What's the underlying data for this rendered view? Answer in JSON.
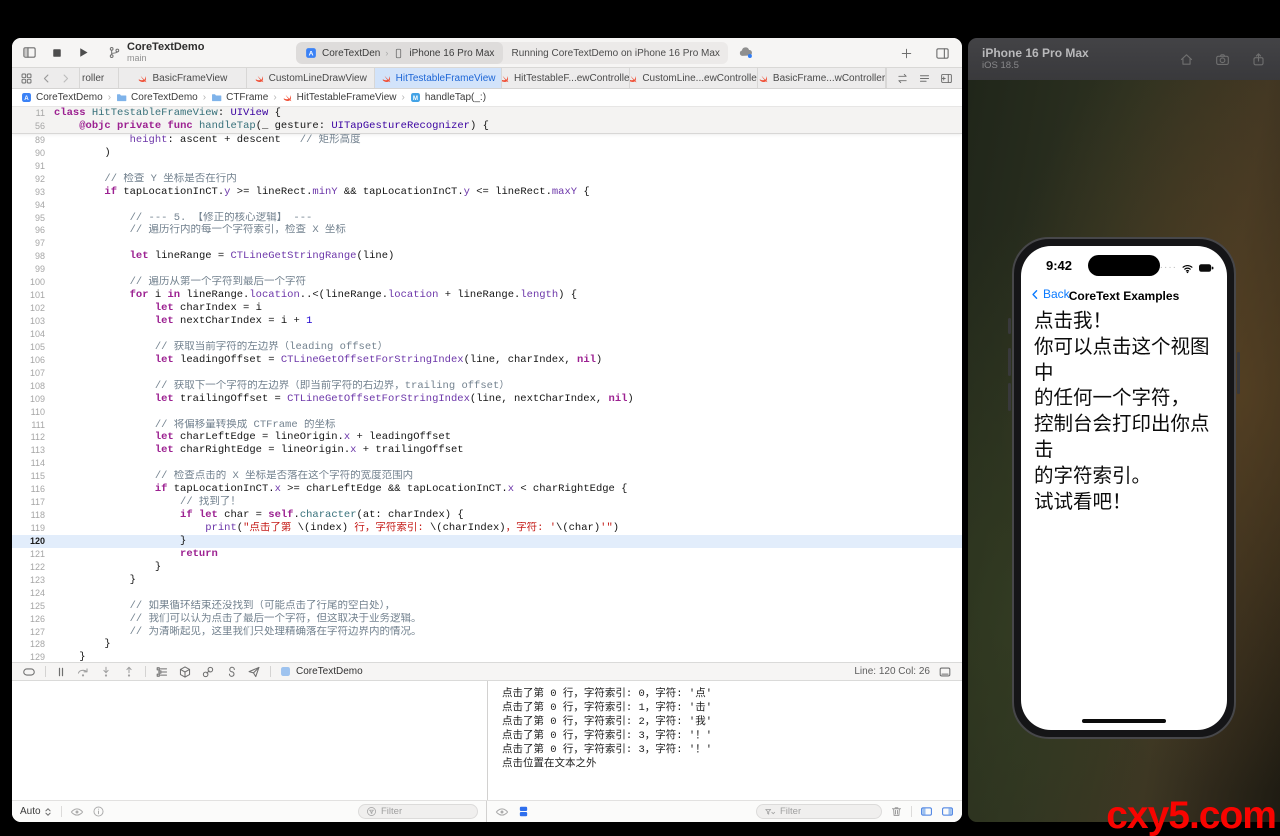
{
  "window": {
    "project": "CoreTextDemo",
    "branch": "main",
    "scheme": "CoreTextDen",
    "device": "iPhone 16 Pro Max",
    "run_status": "Running CoreTextDemo on iPhone 16 Pro Max",
    "chevron": "›"
  },
  "tabbar": {
    "tabs": [
      {
        "label": "roller",
        "clipped": true,
        "active": false
      },
      {
        "label": "BasicFrameView",
        "active": false
      },
      {
        "label": "CustomLineDrawView",
        "active": false
      },
      {
        "label": "HitTestableFrameView",
        "active": true
      },
      {
        "label": "HitTestableF...ewController",
        "active": false
      },
      {
        "label": "CustomLine...ewController",
        "active": false
      },
      {
        "label": "BasicFrame...wController",
        "active": false
      }
    ]
  },
  "breadcrumb": {
    "items": [
      {
        "icon": "app",
        "label": "CoreTextDemo"
      },
      {
        "icon": "folder",
        "label": "CoreTextDemo"
      },
      {
        "icon": "folder",
        "label": "CTFrame"
      },
      {
        "icon": "swift",
        "label": "HitTestableFrameView"
      },
      {
        "icon": "method",
        "label": "handleTap(_:)"
      }
    ]
  },
  "editor": {
    "current_line": 120,
    "sticky_lines": [
      {
        "n": 11,
        "t": [
          [
            "k",
            "class "
          ],
          [
            "t",
            "HitTestableFrameView"
          ],
          [
            "p",
            ": "
          ],
          [
            "F",
            "UIView"
          ],
          [
            "p",
            " {"
          ]
        ]
      },
      {
        "n": 56,
        "t": [
          [
            "p",
            "    "
          ],
          [
            "k",
            "@objc"
          ],
          [
            "p",
            " "
          ],
          [
            "k",
            "private"
          ],
          [
            "p",
            " "
          ],
          [
            "k",
            "func"
          ],
          [
            "p",
            " "
          ],
          [
            "t",
            "handleTap"
          ],
          [
            "p",
            "(_ gesture: "
          ],
          [
            "F",
            "UITapGestureRecognizer"
          ],
          [
            "p",
            ") {"
          ]
        ]
      }
    ],
    "lines": [
      {
        "n": 89,
        "t": [
          [
            "p",
            "            "
          ],
          [
            "f",
            "height"
          ],
          [
            "p",
            ": ascent + descent   "
          ],
          [
            "c",
            "// 矩形高度"
          ]
        ]
      },
      {
        "n": 90,
        "t": [
          [
            "p",
            "        )"
          ]
        ]
      },
      {
        "n": 91,
        "t": []
      },
      {
        "n": 92,
        "t": [
          [
            "p",
            "        "
          ],
          [
            "c",
            "// 检查 Y 坐标是否在行内"
          ]
        ]
      },
      {
        "n": 93,
        "t": [
          [
            "p",
            "        "
          ],
          [
            "k",
            "if"
          ],
          [
            "p",
            " tapLocationInCT."
          ],
          [
            "f",
            "y"
          ],
          [
            "p",
            " >= lineRect."
          ],
          [
            "f",
            "minY"
          ],
          [
            "p",
            " && tapLocationInCT."
          ],
          [
            "f",
            "y"
          ],
          [
            "p",
            " <= lineRect."
          ],
          [
            "f",
            "maxY"
          ],
          [
            "p",
            " {"
          ]
        ]
      },
      {
        "n": 94,
        "t": []
      },
      {
        "n": 95,
        "t": [
          [
            "p",
            "            "
          ],
          [
            "c",
            "// --- 5. 【修正的核心逻辑】 ---"
          ]
        ]
      },
      {
        "n": 96,
        "t": [
          [
            "p",
            "            "
          ],
          [
            "c",
            "// 遍历行内的每一个字符索引，检查 X 坐标"
          ]
        ]
      },
      {
        "n": 97,
        "t": []
      },
      {
        "n": 98,
        "t": [
          [
            "p",
            "            "
          ],
          [
            "k",
            "let"
          ],
          [
            "p",
            " lineRange = "
          ],
          [
            "f",
            "CTLineGetStringRange"
          ],
          [
            "p",
            "(line)"
          ]
        ]
      },
      {
        "n": 99,
        "t": []
      },
      {
        "n": 100,
        "t": [
          [
            "p",
            "            "
          ],
          [
            "c",
            "// 遍历从第一个字符到最后一个字符"
          ]
        ]
      },
      {
        "n": 101,
        "t": [
          [
            "p",
            "            "
          ],
          [
            "k",
            "for"
          ],
          [
            "p",
            " i "
          ],
          [
            "k",
            "in"
          ],
          [
            "p",
            " lineRange."
          ],
          [
            "f",
            "location"
          ],
          [
            "p",
            "..<(lineRange."
          ],
          [
            "f",
            "location"
          ],
          [
            "p",
            " + lineRange."
          ],
          [
            "f",
            "length"
          ],
          [
            "p",
            ") {"
          ]
        ]
      },
      {
        "n": 102,
        "t": [
          [
            "p",
            "                "
          ],
          [
            "k",
            "let"
          ],
          [
            "p",
            " charIndex = i"
          ]
        ]
      },
      {
        "n": 103,
        "t": [
          [
            "p",
            "                "
          ],
          [
            "k",
            "let"
          ],
          [
            "p",
            " nextCharIndex = i + "
          ],
          [
            "n2",
            "1"
          ]
        ]
      },
      {
        "n": 104,
        "t": []
      },
      {
        "n": 105,
        "t": [
          [
            "p",
            "                "
          ],
          [
            "c",
            "// 获取当前字符的左边界（leading offset）"
          ]
        ]
      },
      {
        "n": 106,
        "t": [
          [
            "p",
            "                "
          ],
          [
            "k",
            "let"
          ],
          [
            "p",
            " leadingOffset = "
          ],
          [
            "f",
            "CTLineGetOffsetForStringIndex"
          ],
          [
            "p",
            "(line, charIndex, "
          ],
          [
            "k",
            "nil"
          ],
          [
            "p",
            ")"
          ]
        ]
      },
      {
        "n": 107,
        "t": []
      },
      {
        "n": 108,
        "t": [
          [
            "p",
            "                "
          ],
          [
            "c",
            "// 获取下一个字符的左边界（即当前字符的右边界，trailing offset）"
          ]
        ]
      },
      {
        "n": 109,
        "t": [
          [
            "p",
            "                "
          ],
          [
            "k",
            "let"
          ],
          [
            "p",
            " trailingOffset = "
          ],
          [
            "f",
            "CTLineGetOffsetForStringIndex"
          ],
          [
            "p",
            "(line, nextCharIndex, "
          ],
          [
            "k",
            "nil"
          ],
          [
            "p",
            ")"
          ]
        ]
      },
      {
        "n": 110,
        "t": []
      },
      {
        "n": 111,
        "t": [
          [
            "p",
            "                "
          ],
          [
            "c",
            "// 将偏移量转换成 CTFrame 的坐标"
          ]
        ]
      },
      {
        "n": 112,
        "t": [
          [
            "p",
            "                "
          ],
          [
            "k",
            "let"
          ],
          [
            "p",
            " charLeftEdge = lineOrigin."
          ],
          [
            "f",
            "x"
          ],
          [
            "p",
            " + leadingOffset"
          ]
        ]
      },
      {
        "n": 113,
        "t": [
          [
            "p",
            "                "
          ],
          [
            "k",
            "let"
          ],
          [
            "p",
            " charRightEdge = lineOrigin."
          ],
          [
            "f",
            "x"
          ],
          [
            "p",
            " + trailingOffset"
          ]
        ]
      },
      {
        "n": 114,
        "t": []
      },
      {
        "n": 115,
        "t": [
          [
            "p",
            "                "
          ],
          [
            "c",
            "// 检查点击的 X 坐标是否落在这个字符的宽度范围内"
          ]
        ]
      },
      {
        "n": 116,
        "t": [
          [
            "p",
            "                "
          ],
          [
            "k",
            "if"
          ],
          [
            "p",
            " tapLocationInCT."
          ],
          [
            "f",
            "x"
          ],
          [
            "p",
            " >= charLeftEdge && tapLocationInCT."
          ],
          [
            "f",
            "x"
          ],
          [
            "p",
            " < charRightEdge {"
          ]
        ]
      },
      {
        "n": 117,
        "t": [
          [
            "p",
            "                    "
          ],
          [
            "c",
            "// 找到了！"
          ]
        ]
      },
      {
        "n": 118,
        "t": [
          [
            "p",
            "                    "
          ],
          [
            "k",
            "if"
          ],
          [
            "p",
            " "
          ],
          [
            "k",
            "let"
          ],
          [
            "p",
            " char = "
          ],
          [
            "k",
            "self"
          ],
          [
            "p",
            "."
          ],
          [
            "t",
            "character"
          ],
          [
            "p",
            "(at: charIndex) {"
          ]
        ]
      },
      {
        "n": 119,
        "t": [
          [
            "p",
            "                        "
          ],
          [
            "f",
            "print"
          ],
          [
            "p",
            "("
          ],
          [
            "s",
            "\"点击了第 "
          ],
          [
            "p",
            "\\(index)"
          ],
          [
            "s",
            " 行，字符索引: "
          ],
          [
            "p",
            "\\(charIndex)"
          ],
          [
            "s",
            "，字符: '"
          ],
          [
            "p",
            "\\(char)"
          ],
          [
            "s",
            "'\""
          ],
          [
            "p",
            ")"
          ]
        ]
      },
      {
        "n": 120,
        "t": [
          [
            "p",
            "                    }"
          ]
        ]
      },
      {
        "n": 121,
        "t": [
          [
            "p",
            "                    "
          ],
          [
            "k",
            "return"
          ]
        ]
      },
      {
        "n": 122,
        "t": [
          [
            "p",
            "                }"
          ]
        ]
      },
      {
        "n": 123,
        "t": [
          [
            "p",
            "            }"
          ]
        ]
      },
      {
        "n": 124,
        "t": []
      },
      {
        "n": 125,
        "t": [
          [
            "p",
            "            "
          ],
          [
            "c",
            "// 如果循环结束还没找到（可能点击了行尾的空白处），"
          ]
        ]
      },
      {
        "n": 126,
        "t": [
          [
            "p",
            "            "
          ],
          [
            "c",
            "// 我们可以认为点击了最后一个字符，但这取决于业务逻辑。"
          ]
        ]
      },
      {
        "n": 127,
        "t": [
          [
            "p",
            "            "
          ],
          [
            "c",
            "// 为清晰起见，这里我们只处理精确落在字符边界内的情况。"
          ]
        ]
      },
      {
        "n": 128,
        "t": [
          [
            "p",
            "        }"
          ]
        ]
      },
      {
        "n": 129,
        "t": [
          [
            "p",
            "    }"
          ]
        ]
      }
    ]
  },
  "debugbar": {
    "app": "CoreTextDemo",
    "line_col": "Line: 120 Col: 26"
  },
  "console": {
    "lines": [
      "点击了第 0 行，字符索引: 0，字符: '点'",
      "点击了第 0 行，字符索引: 1，字符: '击'",
      "点击了第 0 行，字符索引: 2，字符: '我'",
      "点击了第 0 行，字符索引: 3，字符: '！'",
      "点击了第 0 行，字符索引: 3，字符: '！'",
      "点击位置在文本之外"
    ]
  },
  "bottombar": {
    "scope": "Auto",
    "filter_placeholder": "Filter"
  },
  "simulator": {
    "device": "iPhone 16 Pro Max",
    "os": "iOS 18.5",
    "phone": {
      "time": "9:42",
      "back_label": "Back",
      "nav_title": "CoreText Examples",
      "body_lines": [
        "点击我！",
        "你可以点击这个视图中",
        "的任何一个字符，",
        "控制台会打印出你点击",
        "的字符索引。",
        "试试看吧！"
      ]
    }
  },
  "watermark": "cxy5.com",
  "colors": {
    "accent_blue": "#1d66d6",
    "active_tab_bg": "#d2e3fa",
    "keyword": "#9c2191",
    "string": "#c41a16",
    "comment": "#73828f",
    "watermark_red": "#f90400",
    "ios_link_blue": "#0a7aff"
  }
}
